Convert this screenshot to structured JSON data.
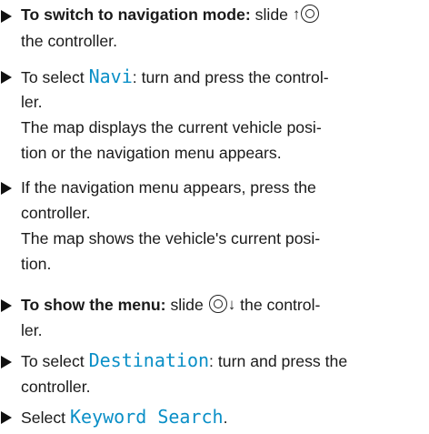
{
  "steps": [
    {
      "bold": "To switch to navigation mode:",
      "text1": " slide ",
      "arrow": "↑",
      "line2": "the controller."
    },
    {
      "pre": "To select ",
      "ui": "Navi",
      "post": ": turn and press the control-",
      "line2": "ler.",
      "line3": "The map displays the current vehicle posi-",
      "line4": "tion or the navigation menu appears."
    },
    {
      "line1": "If the navigation menu appears, press the",
      "line2": "controller.",
      "line3": "The map shows the vehicle's current posi-",
      "line4": "tion."
    },
    {
      "bold": "To show the menu:",
      "text1": " slide ",
      "arrow": "↓",
      "text2": " the control-",
      "line2": "ler."
    },
    {
      "pre": "To select ",
      "ui": "Destination",
      "post": ": turn and press the",
      "line2": "controller."
    },
    {
      "pre": "Select ",
      "ui": "Keyword Search",
      "post": "."
    }
  ]
}
